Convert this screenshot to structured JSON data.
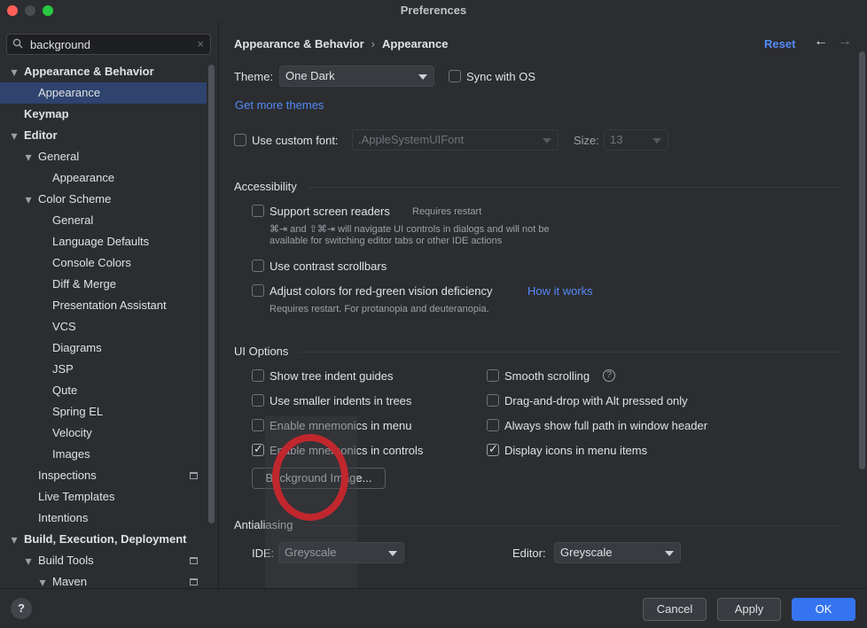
{
  "window": {
    "title": "Preferences"
  },
  "search": {
    "value": "background",
    "clear": "×"
  },
  "tree": [
    {
      "label": "Appearance & Behavior",
      "level": 0,
      "chevron": "down",
      "bold": true
    },
    {
      "label": "Appearance",
      "level": 1,
      "selected": true
    },
    {
      "label": "Keymap",
      "level": 0,
      "bold": true
    },
    {
      "label": "Editor",
      "level": 0,
      "chevron": "down",
      "bold": true
    },
    {
      "label": "General",
      "level": 1,
      "chevron": "down"
    },
    {
      "label": "Appearance",
      "level": 2
    },
    {
      "label": "Color Scheme",
      "level": 1,
      "chevron": "down"
    },
    {
      "label": "General",
      "level": 2
    },
    {
      "label": "Language Defaults",
      "level": 2
    },
    {
      "label": "Console Colors",
      "level": 2
    },
    {
      "label": "Diff & Merge",
      "level": 2
    },
    {
      "label": "Presentation Assistant",
      "level": 2
    },
    {
      "label": "VCS",
      "level": 2
    },
    {
      "label": "Diagrams",
      "level": 2
    },
    {
      "label": "JSP",
      "level": 2
    },
    {
      "label": "Qute",
      "level": 2
    },
    {
      "label": "Spring EL",
      "level": 2
    },
    {
      "label": "Velocity",
      "level": 2
    },
    {
      "label": "Images",
      "level": 2
    },
    {
      "label": "Inspections",
      "level": 1,
      "badge": true
    },
    {
      "label": "Live Templates",
      "level": 1
    },
    {
      "label": "Intentions",
      "level": 1
    },
    {
      "label": "Build, Execution, Deployment",
      "level": 0,
      "chevron": "down",
      "bold": true
    },
    {
      "label": "Build Tools",
      "level": 1,
      "chevron": "down",
      "badge": true
    },
    {
      "label": "Maven",
      "level": 2,
      "chevron": "down",
      "badge": true
    }
  ],
  "breadcrumb": {
    "parent": "Appearance & Behavior",
    "separator": "›",
    "current": "Appearance"
  },
  "header": {
    "reset": "Reset",
    "back": "←",
    "forward": "→"
  },
  "theme": {
    "label": "Theme:",
    "value": "One Dark",
    "sync_label": "Sync with OS",
    "sync_checked": false
  },
  "get_more_themes": "Get more themes",
  "custom_font": {
    "label": "Use custom font:",
    "checked": false,
    "font": ".AppleSystemUIFont",
    "size_label": "Size:",
    "size": "13"
  },
  "accessibility": {
    "title": "Accessibility",
    "screen_readers": {
      "label": "Support screen readers",
      "note": "Requires restart",
      "hint1": "⌘⇥ and ⇧⌘⇥ will navigate UI controls in dialogs and will not be",
      "hint2": "available for switching editor tabs or other IDE actions",
      "checked": false
    },
    "contrast_scrollbars": {
      "label": "Use contrast scrollbars",
      "checked": false
    },
    "red_green": {
      "label": "Adjust colors for red-green vision deficiency",
      "link": "How it works",
      "hint": "Requires restart. For protanopia and deuteranopia.",
      "checked": false
    }
  },
  "ui_options": {
    "title": "UI Options",
    "left": [
      {
        "label": "Show tree indent guides",
        "checked": false
      },
      {
        "label": "Use smaller indents in trees",
        "checked": false
      },
      {
        "label": "Enable mnemonics in menu",
        "checked": false
      },
      {
        "label": "Enable mnemonics in controls",
        "checked": true
      }
    ],
    "right": [
      {
        "label": "Smooth scrolling",
        "checked": false,
        "help": "?"
      },
      {
        "label": "Drag-and-drop with Alt pressed only",
        "checked": false
      },
      {
        "label": "Always show full path in window header",
        "checked": false
      },
      {
        "label": "Display icons in menu items",
        "checked": true
      }
    ],
    "background_image_button": "Background Image..."
  },
  "antialiasing": {
    "title": "Antialiasing",
    "ide_label": "IDE:",
    "ide_value": "Greyscale",
    "editor_label": "Editor:",
    "editor_value": "Greyscale"
  },
  "footer": {
    "help": "?",
    "cancel": "Cancel",
    "apply": "Apply",
    "ok": "OK"
  },
  "colors": {
    "accent": "#3574f0",
    "link": "#548af7",
    "selection": "#2e436e",
    "annotation": "#c0272d"
  }
}
